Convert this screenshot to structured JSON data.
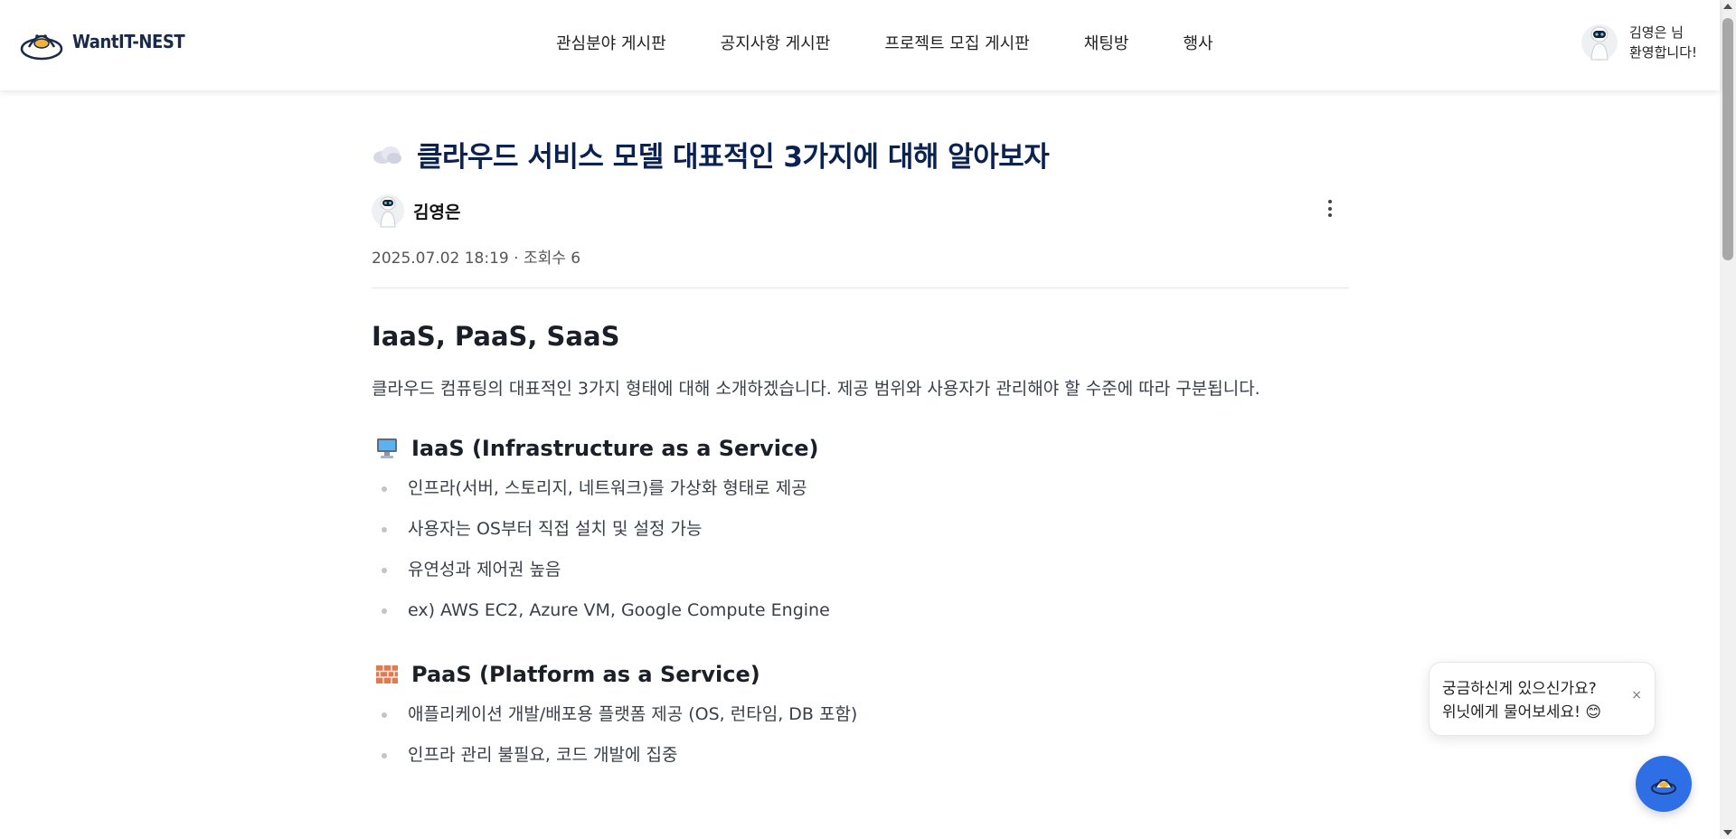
{
  "header": {
    "logo_text": "WantIT-NEST",
    "nav": [
      {
        "label": "관심분야 게시판"
      },
      {
        "label": "공지사항 게시판"
      },
      {
        "label": "프로젝트 모집 게시판"
      },
      {
        "label": "채팅방"
      },
      {
        "label": "행사"
      }
    ],
    "user": {
      "line1": "김영은 님",
      "line2": "환영합니다!"
    }
  },
  "post": {
    "title_icon": "cloud-icon",
    "title": "클라우드 서비스 모델 대표적인 3가지에 대해 알아보자",
    "author": "김영은",
    "date": "2025.07.02 18:19",
    "views": "· 조회수 6",
    "heading": "IaaS, PaaS, SaaS",
    "intro": "클라우드 컴퓨팅의 대표적인 3가지 형태에 대해 소개하겠습니다. 제공 범위와 사용자가 관리해야 할 수준에 따라 구분됩니다.",
    "sections": [
      {
        "icon": "computer-icon",
        "title": "IaaS (Infrastructure as a Service)",
        "items": [
          "인프라(서버, 스토리지, 네트워크)를 가상화 형태로 제공",
          "사용자는 OS부터 직접 설치 및 설정 가능",
          "유연성과 제어권 높음",
          "ex) AWS EC2, Azure VM, Google Compute Engine"
        ]
      },
      {
        "icon": "brick-icon",
        "title": "PaaS (Platform as a Service)",
        "items": [
          "애플리케이션 개발/배포용 플랫폼 제공 (OS, 런타임, DB 포함)",
          "인프라 관리 불필요, 코드 개발에 집중"
        ]
      }
    ]
  },
  "chat": {
    "line1": "궁금하신게 있으신가요?",
    "line2": "위닛에게 물어보세요! 😊",
    "close": "×"
  },
  "colors": {
    "title": "#0b2251",
    "fab": "#2e6fe6"
  }
}
